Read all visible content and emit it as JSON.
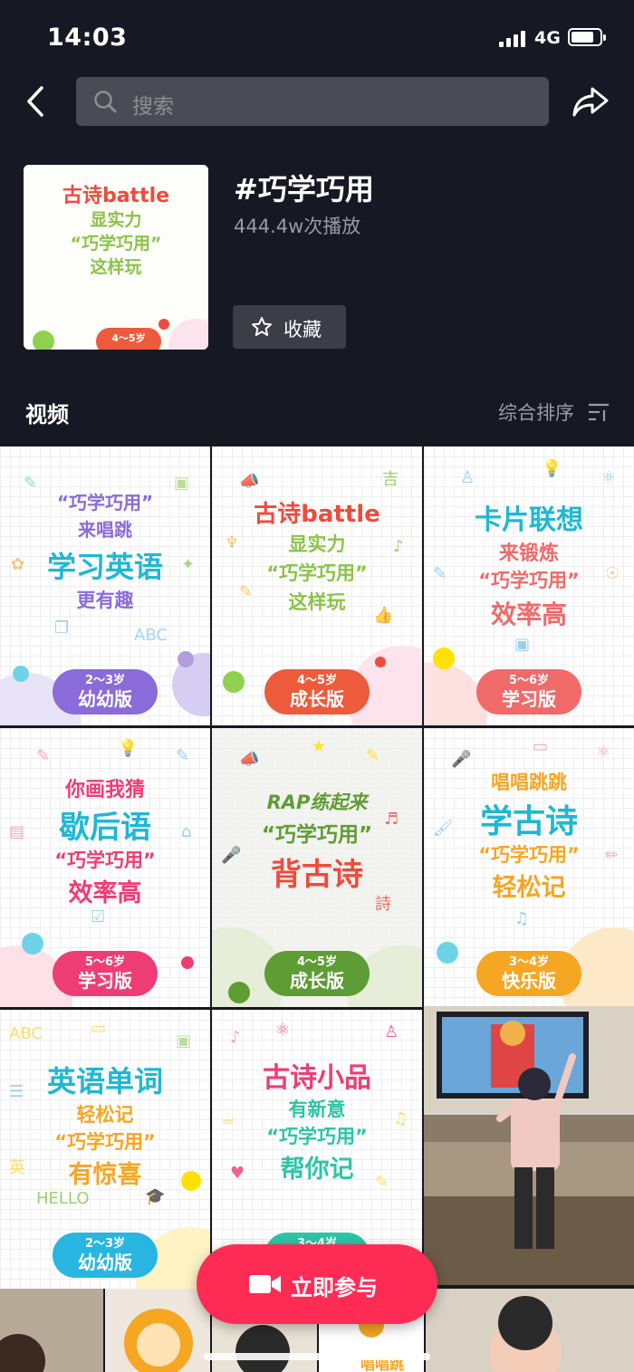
{
  "status_bar": {
    "time": "14:03",
    "network": "4G"
  },
  "search": {
    "placeholder": "搜索"
  },
  "topic": {
    "title": "#巧学巧用",
    "plays": "444.4w次播放",
    "favorite_label": "收藏",
    "cover": {
      "line1": "古诗battle",
      "line2": "显实力",
      "line3": "“巧学巧用”",
      "line4": "这样玩",
      "age": "4～5岁"
    }
  },
  "section": {
    "title": "视频",
    "sort_label": "综合排序"
  },
  "tiles": [
    {
      "lines": [
        "“巧学巧用”",
        "来唱跳",
        "学习英语",
        "更有趣"
      ],
      "age": "2～3岁",
      "version": "幼幼版",
      "pill_color": "#8b6bd9"
    },
    {
      "lines": [
        "古诗battle",
        "显实力",
        "“巧学巧用”",
        "这样玩"
      ],
      "age": "4～5岁",
      "version": "成长版",
      "pill_color": "#ee5a3c"
    },
    {
      "lines": [
        "卡片联想",
        "来锻炼",
        "“巧学巧用”",
        "效率高"
      ],
      "age": "5～6岁",
      "version": "学习版",
      "pill_color": "#f06a6a"
    },
    {
      "lines": [
        "你画我猜",
        "歇后语",
        "“巧学巧用”",
        "效率高"
      ],
      "age": "5～6岁",
      "version": "学习版",
      "pill_color": "#ee3d74"
    },
    {
      "lines": [
        "RAP练起来",
        "“巧学巧用”",
        "背古诗"
      ],
      "age": "4～5岁",
      "version": "成长版",
      "pill_color": "#5e9c34"
    },
    {
      "lines": [
        "唱唱跳跳",
        "学古诗",
        "“巧学巧用”",
        "轻松记"
      ],
      "age": "3～4岁",
      "version": "快乐版",
      "pill_color": "#f5a623"
    },
    {
      "lines": [
        "英语单词",
        "轻松记",
        "“巧学巧用”",
        "有惊喜"
      ],
      "age": "2～3岁",
      "version": "幼幼版",
      "pill_color": "#28b6e0"
    },
    {
      "lines": [
        "古诗小品",
        "有新意",
        "“巧学巧用”",
        "帮你记"
      ],
      "age": "3～4岁",
      "version": "",
      "pill_color": "#2ec4a6"
    }
  ],
  "bottom_row_text": "唱唱跳",
  "cta": {
    "label": "立即参与"
  },
  "colors": {
    "background": "#161823",
    "accent": "#fe2c55"
  }
}
